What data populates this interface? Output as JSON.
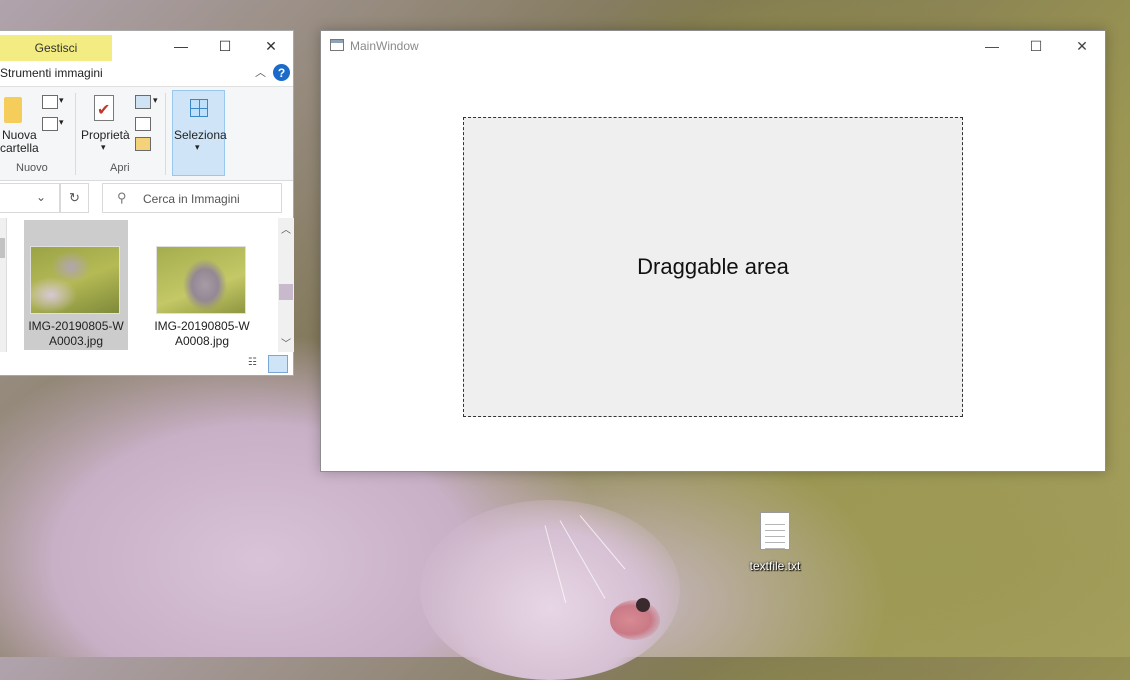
{
  "explorer": {
    "context_tab": "Gestisci",
    "ribbon_tab": "Strumenti immagini",
    "help": "?",
    "new_folder_label_1": "Nuova",
    "new_folder_label_2": "cartella",
    "group_new": "Nuovo",
    "properties_label": "Proprietà",
    "group_open": "Apri",
    "select_label": "Seleziona",
    "search_placeholder": "Cerca in Immagini",
    "files": [
      {
        "name_line1": "IMG-20190805-W",
        "name_line2": "A0003.jpg",
        "selected": true
      },
      {
        "name_line1": "IMG-20190805-W",
        "name_line2": "A0008.jpg",
        "selected": false
      }
    ]
  },
  "mainwindow": {
    "title": "MainWindow",
    "drag_area_text": "Draggable area"
  },
  "desktop": {
    "icon_label": "textfile.txt"
  },
  "icons": {
    "minimize": "minimize-icon",
    "maximize": "maximize-icon",
    "close": "close-icon",
    "search": "search-icon",
    "refresh": "refresh-icon",
    "file": "text-file-icon"
  },
  "colors": {
    "context_tab_bg": "#f2ec82",
    "selection_bg": "#cfe5f7",
    "drag_area_bg": "#efefef"
  }
}
